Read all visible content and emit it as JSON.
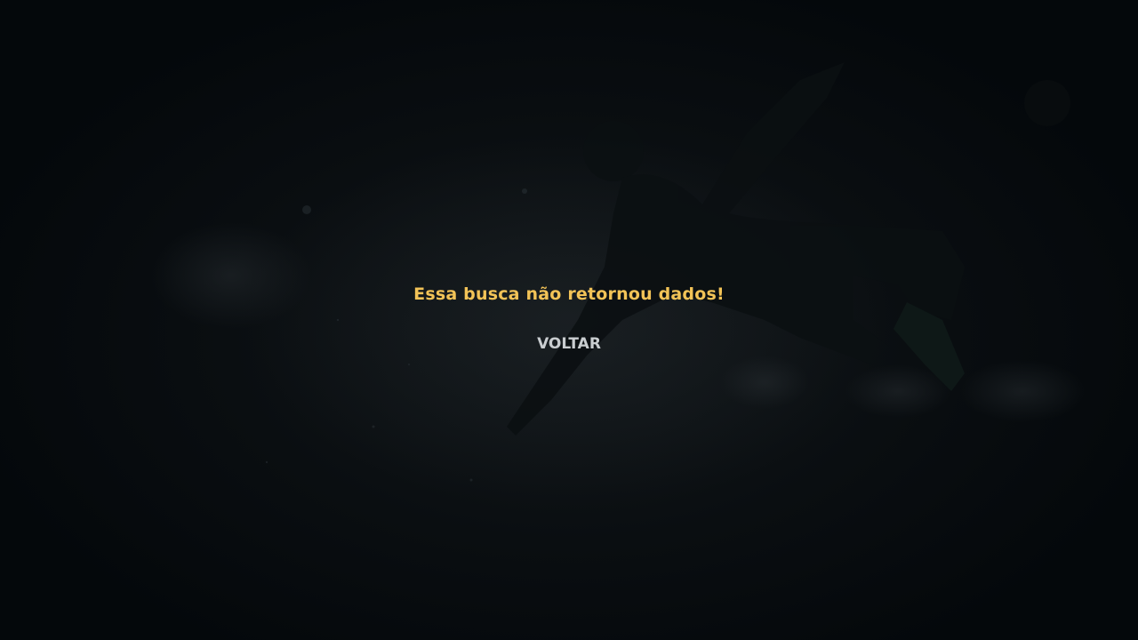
{
  "empty_state": {
    "message": "Essa busca não retornou dados!",
    "back_label": "VOLTAR"
  },
  "background": {
    "description_icon": "soccer-player-bicycle-kick-silhouette"
  },
  "colors": {
    "message": "#f2c357",
    "back_button": "#c9cdd0",
    "background": "#05090c"
  }
}
